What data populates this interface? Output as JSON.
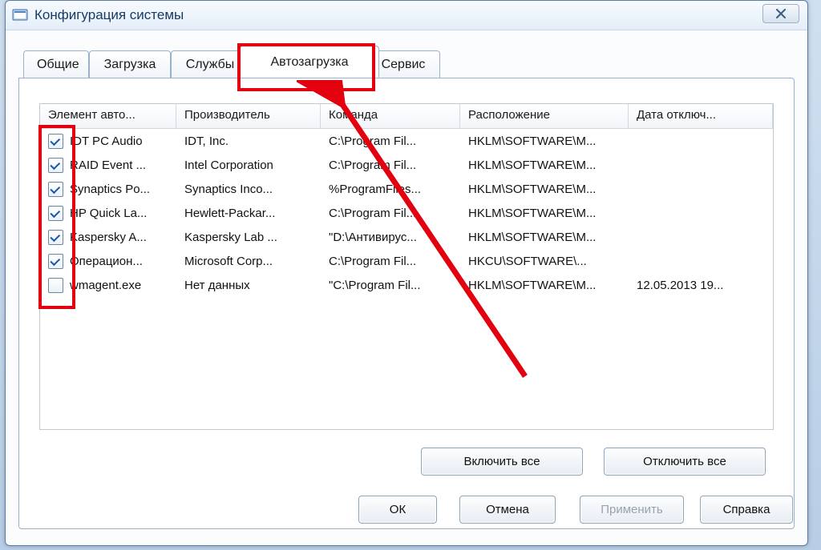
{
  "window": {
    "title": "Конфигурация системы"
  },
  "tabs": {
    "general": "Общие",
    "boot": "Загрузка",
    "services": "Службы",
    "startup": "Автозагрузка",
    "tools": "Сервис"
  },
  "columns": {
    "item": "Элемент авто...",
    "vendor": "Производитель",
    "command": "Команда",
    "location": "Расположение",
    "date": "Дата отключ..."
  },
  "rows": [
    {
      "checked": true,
      "item": "IDT PC Audio",
      "vendor": "IDT, Inc.",
      "command": "C:\\Program Fil...",
      "location": "HKLM\\SOFTWARE\\M...",
      "date": ""
    },
    {
      "checked": true,
      "item": "RAID Event ...",
      "vendor": "Intel Corporation",
      "command": "C:\\Program Fil...",
      "location": "HKLM\\SOFTWARE\\M...",
      "date": ""
    },
    {
      "checked": true,
      "item": "Synaptics Po...",
      "vendor": "Synaptics Inco...",
      "command": "%ProgramFiles...",
      "location": "HKLM\\SOFTWARE\\M...",
      "date": ""
    },
    {
      "checked": true,
      "item": "HP Quick La...",
      "vendor": "Hewlett-Packar...",
      "command": "C:\\Program Fil...",
      "location": "HKLM\\SOFTWARE\\M...",
      "date": ""
    },
    {
      "checked": true,
      "item": "Kaspersky A...",
      "vendor": "Kaspersky Lab ...",
      "command": "\"D:\\Антивирус...",
      "location": "HKLM\\SOFTWARE\\M...",
      "date": ""
    },
    {
      "checked": true,
      "item": "Операцион...",
      "vendor": "Microsoft Corp...",
      "command": "C:\\Program Fil...",
      "location": "HKCU\\SOFTWARE\\...",
      "date": ""
    },
    {
      "checked": false,
      "item": "wmagent.exe",
      "vendor": "Нет данных",
      "command": "\"C:\\Program Fil...",
      "location": "HKLM\\SOFTWARE\\M...",
      "date": "12.05.2013 19..."
    }
  ],
  "buttons": {
    "enable_all": "Включить все",
    "disable_all": "Отключить все",
    "ok": "ОК",
    "cancel": "Отмена",
    "apply": "Применить",
    "help": "Справка"
  }
}
